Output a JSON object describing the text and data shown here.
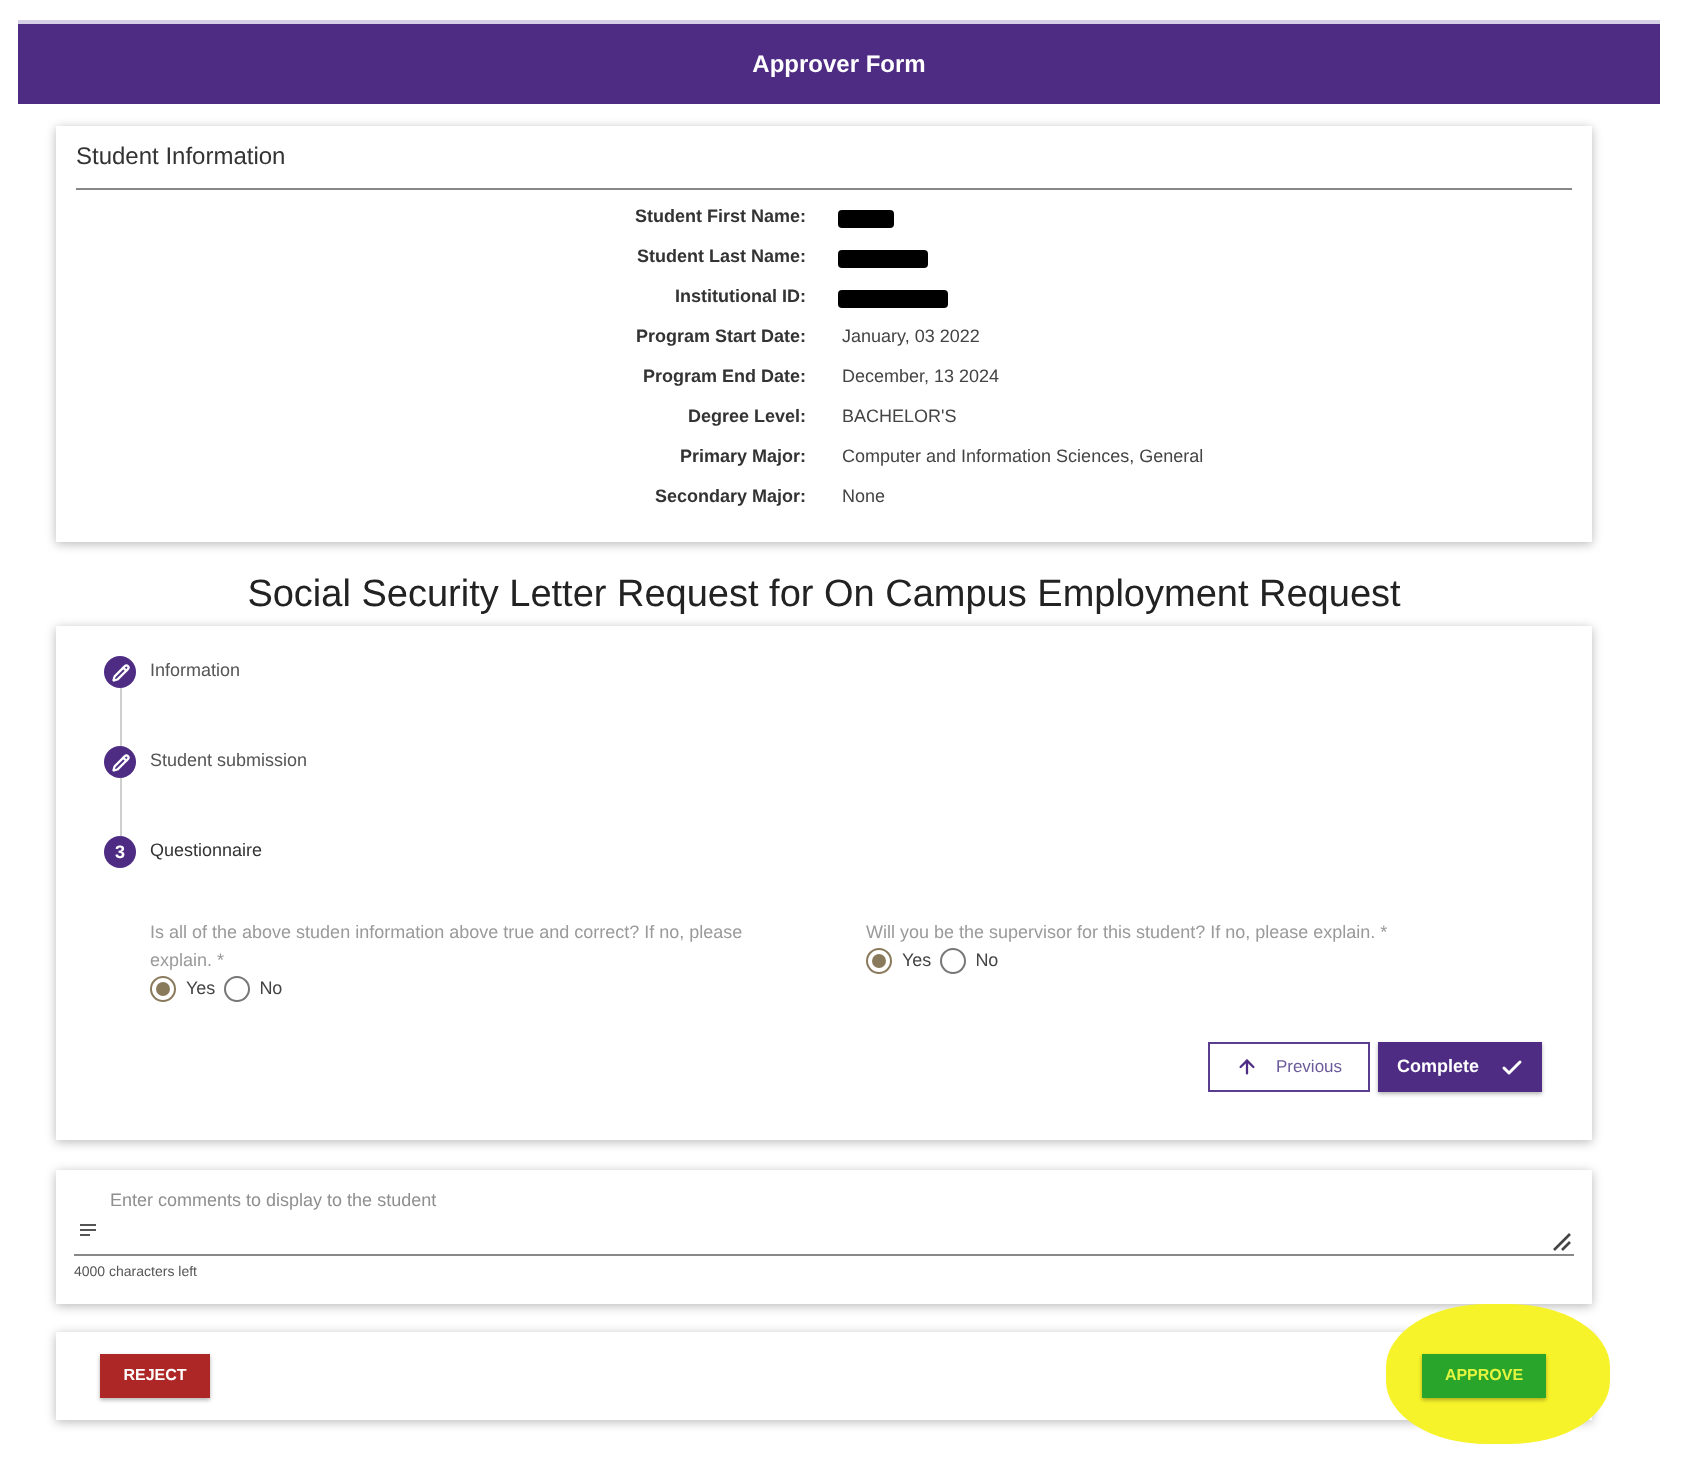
{
  "header": {
    "title": "Approver Form"
  },
  "student_information": {
    "title": "Student Information",
    "fields": [
      {
        "label": "Student First Name:",
        "redacted": true
      },
      {
        "label": "Student Last Name:",
        "redacted": true
      },
      {
        "label": "Institutional ID:",
        "redacted": true
      },
      {
        "label": "Program Start Date:",
        "redacted": false,
        "value": "January, 03 2022"
      },
      {
        "label": "Program End Date:",
        "redacted": false,
        "value": "December, 13 2024"
      },
      {
        "label": "Degree Level:",
        "redacted": false,
        "value": "BACHELOR'S"
      },
      {
        "label": "Primary Major:",
        "redacted": false,
        "value": "Computer and Information Sciences, General"
      },
      {
        "label": "Secondary Major:",
        "redacted": false,
        "value": "None"
      }
    ]
  },
  "request_title": "Social Security Letter Request for On Campus Employment Request",
  "stepper": {
    "steps": [
      {
        "label": "Information",
        "kind": "done"
      },
      {
        "label": "Student submission",
        "kind": "done"
      },
      {
        "label": "Questionnaire",
        "kind": "current",
        "number": "3"
      }
    ],
    "questions": [
      {
        "text": "Is all of the above studen information above true and correct? If no, please explain. *",
        "options": [
          {
            "label": "Yes",
            "selected": true
          },
          {
            "label": "No",
            "selected": false
          }
        ]
      },
      {
        "text": "Will you be the supervisor for this student? If no, please explain. *",
        "options": [
          {
            "label": "Yes",
            "selected": true
          },
          {
            "label": "No",
            "selected": false
          }
        ]
      }
    ],
    "buttons": [
      {
        "label": "Previous",
        "kind": "previous"
      },
      {
        "label": "Complete",
        "kind": "complete"
      }
    ]
  },
  "comments": {
    "placeholder": "Enter comments to display to the student",
    "counter": "4000 characters left"
  },
  "actions": [
    {
      "label": "REJECT",
      "kind": "reject",
      "highlighted": false
    },
    {
      "label": "APPROVE",
      "kind": "approve",
      "highlighted": true
    }
  ]
}
